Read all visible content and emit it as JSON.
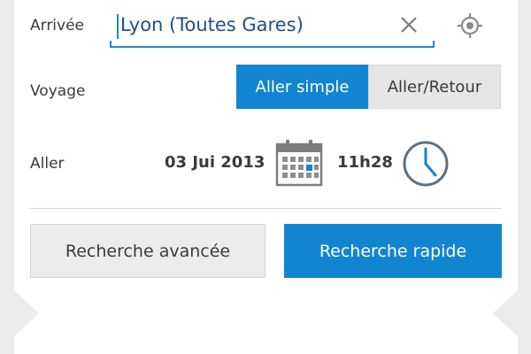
{
  "form": {
    "arrival_label": "Arrivée",
    "arrival_value": "Lyon (Toutes Gares)",
    "trip_label": "Voyage",
    "trip_options": [
      "Aller simple",
      "Aller/Retour"
    ],
    "trip_selected": "Aller simple",
    "outbound_label": "Aller",
    "outbound_date": "03 Jui 2013",
    "outbound_time": "11h28"
  },
  "actions": {
    "advanced_search": "Recherche avancée",
    "quick_search": "Recherche rapide"
  },
  "icons": {
    "clear": "close-icon",
    "locate": "locate-icon",
    "calendar": "calendar-icon",
    "clock": "clock-icon"
  },
  "colors": {
    "accent": "#1185d0",
    "input_text": "#1f4f86",
    "background": "#ececec",
    "card": "#ffffff"
  }
}
